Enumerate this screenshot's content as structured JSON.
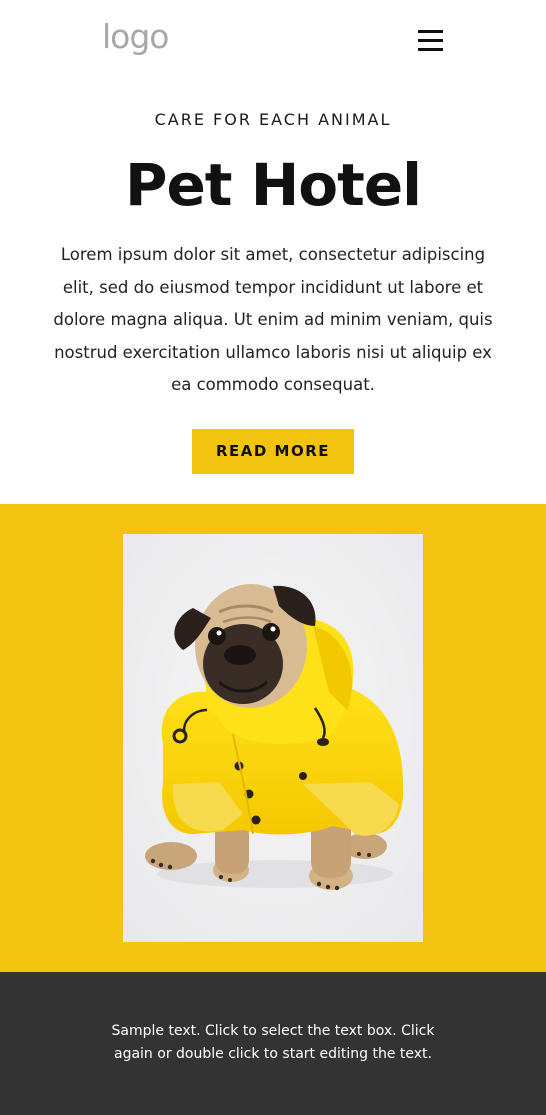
{
  "header": {
    "logo_text": "logo",
    "menu_icon": "hamburger-menu-icon"
  },
  "hero": {
    "eyebrow": "CARE FOR EACH ANIMAL",
    "title": "Pet Hotel",
    "body": "Lorem ipsum dolor sit amet, consectetur adipiscing elit, sed do eiusmod tempor incididunt ut labore et dolore magna aliqua. Ut enim ad minim veniam, quis nostrud exercitation ullamco laboris nisi ut aliquip ex ea commodo consequat.",
    "button_label": "READ MORE"
  },
  "feature": {
    "image_subject": "pug-in-yellow-raincoat"
  },
  "footer": {
    "text": "Sample text. Click to select the text box. Click again or double click to start editing the text."
  },
  "colors": {
    "accent": "#f2c40f",
    "footer_bg": "#333333",
    "text": "#111111",
    "logo": "#a8a8a8"
  }
}
